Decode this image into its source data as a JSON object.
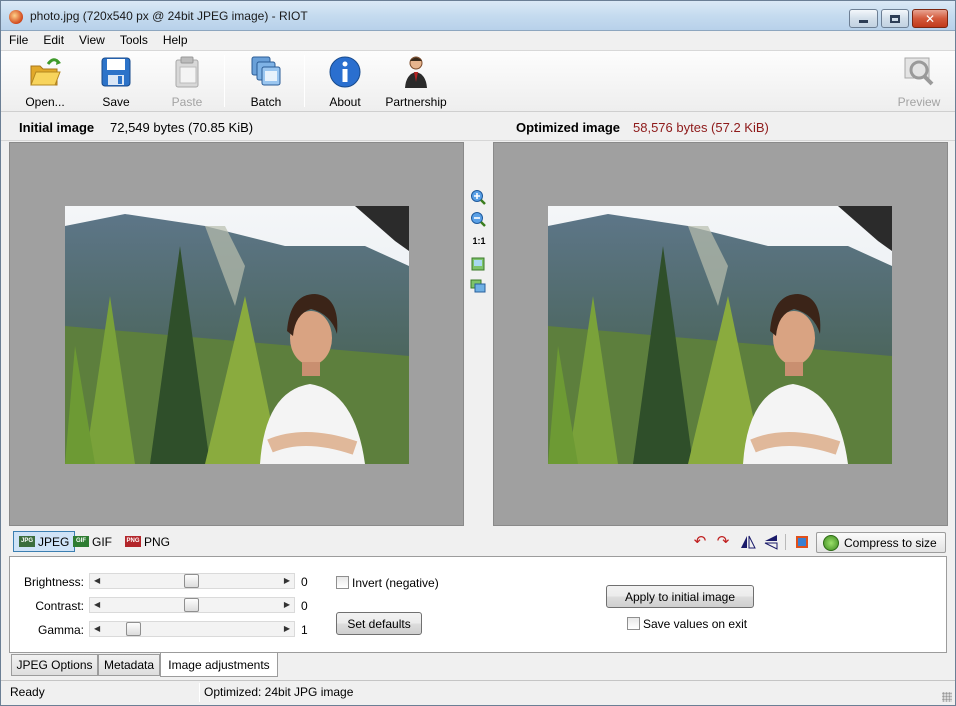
{
  "window": {
    "title": "photo.jpg (720x540 px @ 24bit JPEG image) - RIOT",
    "controls": {
      "minimize": "minimize",
      "maximize": "maximize",
      "close": "✕"
    }
  },
  "menu": [
    "File",
    "Edit",
    "View",
    "Tools",
    "Help"
  ],
  "toolbar": {
    "open": "Open...",
    "save": "Save",
    "paste": "Paste",
    "batch": "Batch",
    "about": "About",
    "partnership": "Partnership",
    "preview": "Preview"
  },
  "info": {
    "initial_label": "Initial image",
    "initial_value": "72,549 bytes (70.85 KiB)",
    "optimized_label": "Optimized image",
    "optimized_value": "58,576 bytes (57.2 KiB)"
  },
  "zoom": {
    "one_to_one": "1:1"
  },
  "format_tabs": [
    {
      "label": "JPEG",
      "badge": "JPG",
      "color": "#3c6e3c",
      "active": true
    },
    {
      "label": "GIF",
      "badge": "GIF",
      "color": "#2f7d32",
      "active": false
    },
    {
      "label": "PNG",
      "badge": "PNG",
      "color": "#b3262b",
      "active": false
    }
  ],
  "compress_button": "Compress to size",
  "adjustments": {
    "brightness_label": "Brightness:",
    "brightness_value": "0",
    "contrast_label": "Contrast:",
    "contrast_value": "0",
    "gamma_label": "Gamma:",
    "gamma_value": "1",
    "invert_label": "Invert (negative)",
    "set_defaults": "Set defaults",
    "apply_initial": "Apply to initial image",
    "save_values": "Save values on exit"
  },
  "bottom_tabs": [
    "JPEG Options",
    "Metadata",
    "Image adjustments"
  ],
  "status": {
    "left": "Ready",
    "right": "Optimized: 24bit JPG image"
  },
  "colors": {
    "optimized_size": "#8e1a1a",
    "pane_background": "#a0a0a0",
    "active_tab": "#cfe3f7"
  }
}
